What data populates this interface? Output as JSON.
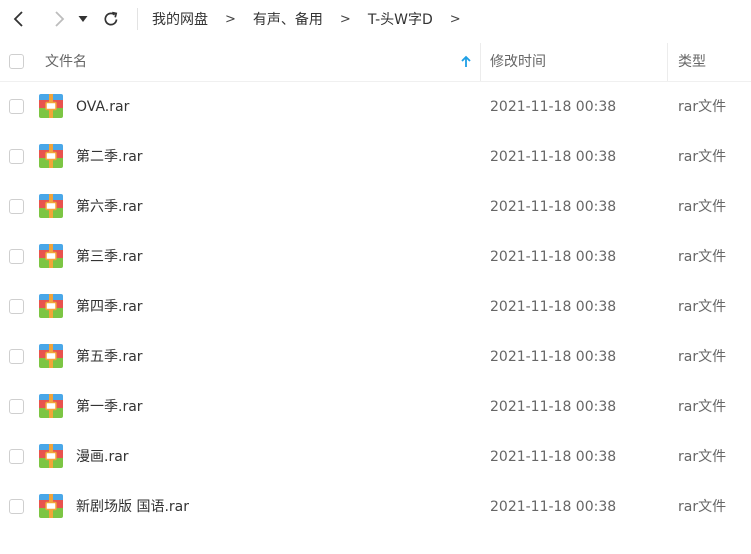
{
  "toolbar": {
    "back_icon": "chevron-left-icon",
    "forward_icon": "chevron-right-icon",
    "history_icon": "caret-down-icon",
    "refresh_icon": "refresh-icon"
  },
  "breadcrumb": {
    "items": [
      "我的网盘",
      "有声、备用",
      "T-头W字D"
    ],
    "separator": ">"
  },
  "table": {
    "columns": {
      "name": "文件名",
      "modified": "修改时间",
      "type": "类型"
    },
    "sort_icon": "arrow-up-icon",
    "accent_color": "#1e9fe5",
    "rows": [
      {
        "name": "OVA.rar",
        "modified": "2021-11-18 00:38",
        "type": "rar文件"
      },
      {
        "name": "第二季.rar",
        "modified": "2021-11-18 00:38",
        "type": "rar文件"
      },
      {
        "name": "第六季.rar",
        "modified": "2021-11-18 00:38",
        "type": "rar文件"
      },
      {
        "name": "第三季.rar",
        "modified": "2021-11-18 00:38",
        "type": "rar文件"
      },
      {
        "name": "第四季.rar",
        "modified": "2021-11-18 00:38",
        "type": "rar文件"
      },
      {
        "name": "第五季.rar",
        "modified": "2021-11-18 00:38",
        "type": "rar文件"
      },
      {
        "name": "第一季.rar",
        "modified": "2021-11-18 00:38",
        "type": "rar文件"
      },
      {
        "name": "漫画.rar",
        "modified": "2021-11-18 00:38",
        "type": "rar文件"
      },
      {
        "name": "新剧场版 国语.rar",
        "modified": "2021-11-18 00:38",
        "type": "rar文件"
      }
    ]
  }
}
